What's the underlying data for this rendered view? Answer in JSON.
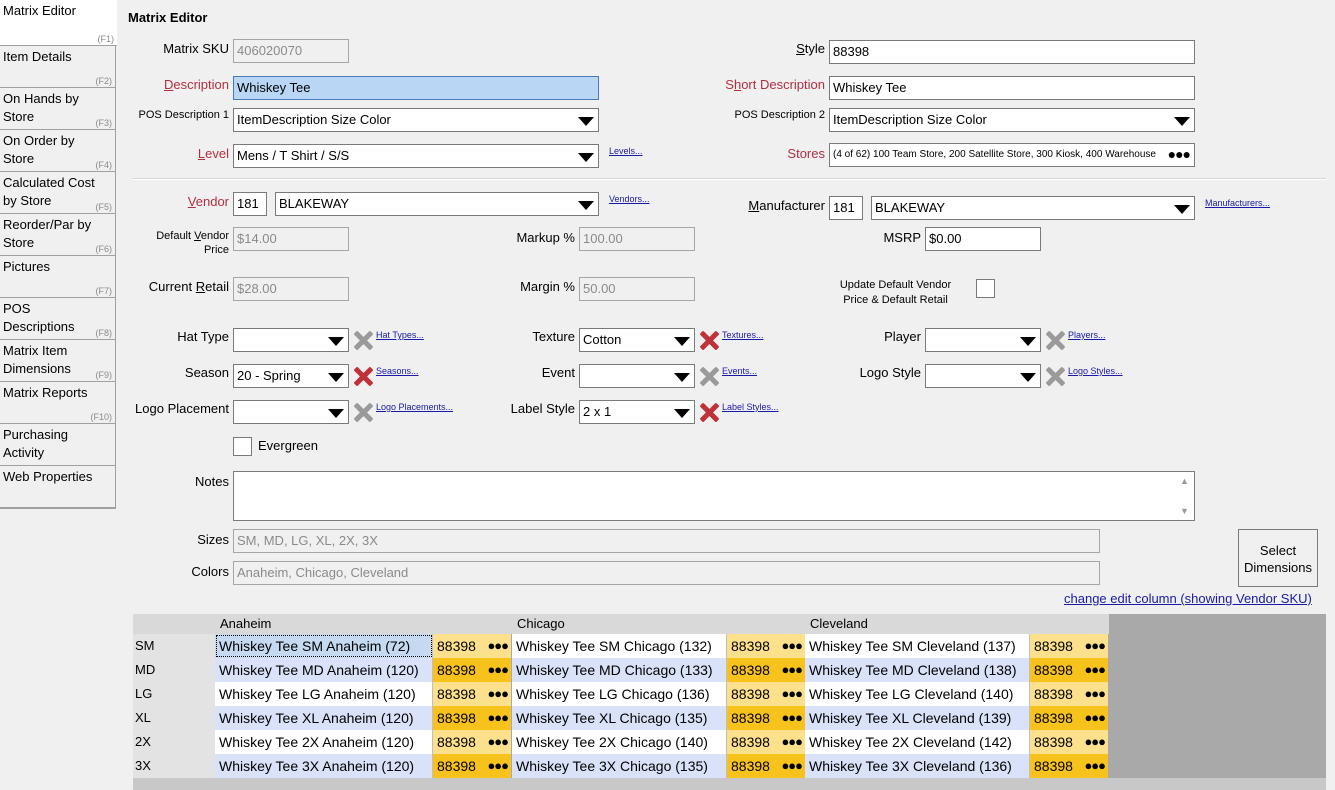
{
  "sidebar": {
    "items": [
      {
        "label": "Matrix Editor",
        "key": "(F1)"
      },
      {
        "label": "Item Details",
        "key": "(F2)"
      },
      {
        "label": "On Hands by Store",
        "key": "(F3)"
      },
      {
        "label": "On Order by Store",
        "key": "(F4)"
      },
      {
        "label": "Calculated Cost by Store",
        "key": "(F5)"
      },
      {
        "label": "Reorder/Par by Store",
        "key": "(F6)"
      },
      {
        "label": "Pictures",
        "key": "(F7)"
      },
      {
        "label": "POS Descriptions",
        "key": "(F8)"
      },
      {
        "label": "Matrix Item Dimensions",
        "key": "(F9)"
      },
      {
        "label": "Matrix Reports",
        "key": "(F10)"
      },
      {
        "label": "Purchasing Activity",
        "key": ""
      },
      {
        "label": "Web Properties",
        "key": ""
      }
    ],
    "active_index": 0
  },
  "page": {
    "title": "Matrix Editor"
  },
  "form": {
    "matrix_sku": {
      "label": "Matrix SKU",
      "value": "406020070"
    },
    "style": {
      "label": "Style",
      "value": "88398"
    },
    "description": {
      "label": "Description",
      "value": "Whiskey Tee"
    },
    "short_description": {
      "label": "Short Description",
      "value": "Whiskey Tee"
    },
    "pos_desc1": {
      "label": "POS Description 1",
      "value": "ItemDescription Size Color"
    },
    "pos_desc2": {
      "label": "POS Description 2",
      "value": "ItemDescription Size Color"
    },
    "level": {
      "label": "Level",
      "value": "Mens / T Shirt / S/S",
      "link": "Levels..."
    },
    "stores": {
      "label": "Stores",
      "value": "(4 of 62) 100 Team Store, 200 Satellite Store, 300 Kiosk, 400 Warehouse"
    },
    "vendor": {
      "label": "Vendor",
      "code": "181",
      "value": "BLAKEWAY",
      "link": "Vendors..."
    },
    "manufacturer": {
      "label": "Manufacturer",
      "code": "181",
      "value": "BLAKEWAY",
      "link": "Manufacturers..."
    },
    "default_vendor_price": {
      "label_line1": "Default Vendor",
      "label_line2": "Price",
      "value": "$14.00"
    },
    "markup": {
      "label": "Markup %",
      "value": "100.00"
    },
    "msrp": {
      "label": "MSRP",
      "value": "$0.00"
    },
    "current_retail": {
      "label": "Current Retail",
      "value": "$28.00"
    },
    "margin": {
      "label": "Margin %",
      "value": "50.00"
    },
    "update_default": {
      "label_line1": "Update Default Vendor",
      "label_line2": "Price & Default Retail",
      "checked": false
    },
    "hat_type": {
      "label": "Hat Type",
      "value": "",
      "link": "Hat Types..."
    },
    "texture": {
      "label": "Texture",
      "value": "Cotton",
      "link": "Textures..."
    },
    "player": {
      "label": "Player",
      "value": "",
      "link": "Players..."
    },
    "season": {
      "label": "Season",
      "value": "20 - Spring",
      "link": "Seasons..."
    },
    "event": {
      "label": "Event",
      "value": "",
      "link": "Events..."
    },
    "logo_style": {
      "label": "Logo Style",
      "value": "",
      "link": "Logo Styles..."
    },
    "logo_placement": {
      "label": "Logo Placement",
      "value": "",
      "link": "Logo Placements..."
    },
    "label_style": {
      "label": "Label Style",
      "value": "2 x 1",
      "link": "Label Styles..."
    },
    "evergreen": {
      "label": "Evergreen",
      "checked": false
    },
    "notes": {
      "label": "Notes",
      "value": ""
    },
    "sizes": {
      "label": "Sizes",
      "value": "SM, MD, LG, XL, 2X, 3X"
    },
    "colors": {
      "label": "Colors",
      "value": "Anaheim, Chicago, Cleveland"
    },
    "select_dimensions": {
      "line1": "Select",
      "line2": "Dimensions"
    },
    "change_edit_column": "change edit column (showing Vendor SKU)"
  },
  "grid": {
    "columns": [
      "Anaheim",
      "Chicago",
      "Cleveland"
    ],
    "rows": [
      {
        "size": "SM",
        "cells": [
          {
            "desc": "Whiskey Tee SM Anaheim (72)",
            "sku": "88398"
          },
          {
            "desc": "Whiskey Tee SM Chicago (132)",
            "sku": "88398"
          },
          {
            "desc": "Whiskey Tee SM Cleveland (137)",
            "sku": "88398"
          }
        ]
      },
      {
        "size": "MD",
        "cells": [
          {
            "desc": "Whiskey Tee MD Anaheim (120)",
            "sku": "88398"
          },
          {
            "desc": "Whiskey Tee MD Chicago (133)",
            "sku": "88398"
          },
          {
            "desc": "Whiskey Tee MD Cleveland (138)",
            "sku": "88398"
          }
        ]
      },
      {
        "size": "LG",
        "cells": [
          {
            "desc": "Whiskey Tee LG Anaheim (120)",
            "sku": "88398"
          },
          {
            "desc": "Whiskey Tee LG Chicago (136)",
            "sku": "88398"
          },
          {
            "desc": "Whiskey Tee LG Cleveland (140)",
            "sku": "88398"
          }
        ]
      },
      {
        "size": "XL",
        "cells": [
          {
            "desc": "Whiskey Tee XL Anaheim (120)",
            "sku": "88398"
          },
          {
            "desc": "Whiskey Tee XL Chicago (135)",
            "sku": "88398"
          },
          {
            "desc": "Whiskey Tee XL Cleveland (139)",
            "sku": "88398"
          }
        ]
      },
      {
        "size": "2X",
        "cells": [
          {
            "desc": "Whiskey Tee 2X Anaheim (120)",
            "sku": "88398"
          },
          {
            "desc": "Whiskey Tee 2X Chicago (140)",
            "sku": "88398"
          },
          {
            "desc": "Whiskey Tee 2X Cleveland (142)",
            "sku": "88398"
          }
        ]
      },
      {
        "size": "3X",
        "cells": [
          {
            "desc": "Whiskey Tee 3X Anaheim (120)",
            "sku": "88398"
          },
          {
            "desc": "Whiskey Tee 3X Chicago (135)",
            "sku": "88398"
          },
          {
            "desc": "Whiskey Tee 3X Cleveland (136)",
            "sku": "88398"
          }
        ]
      }
    ],
    "selected": {
      "row": 0,
      "col": 0
    }
  },
  "colors": {
    "required_label": "#b03040",
    "row_white": "#ffffff",
    "row_blue": "#d9e2f8",
    "sku_light": "#fde08c",
    "sku_dark": "#f7c21b",
    "selected_cell": "#c5d9f1",
    "link": "#1a1aa6",
    "delete_red": "#c0323a",
    "delete_grey": "#9a9a9a"
  }
}
